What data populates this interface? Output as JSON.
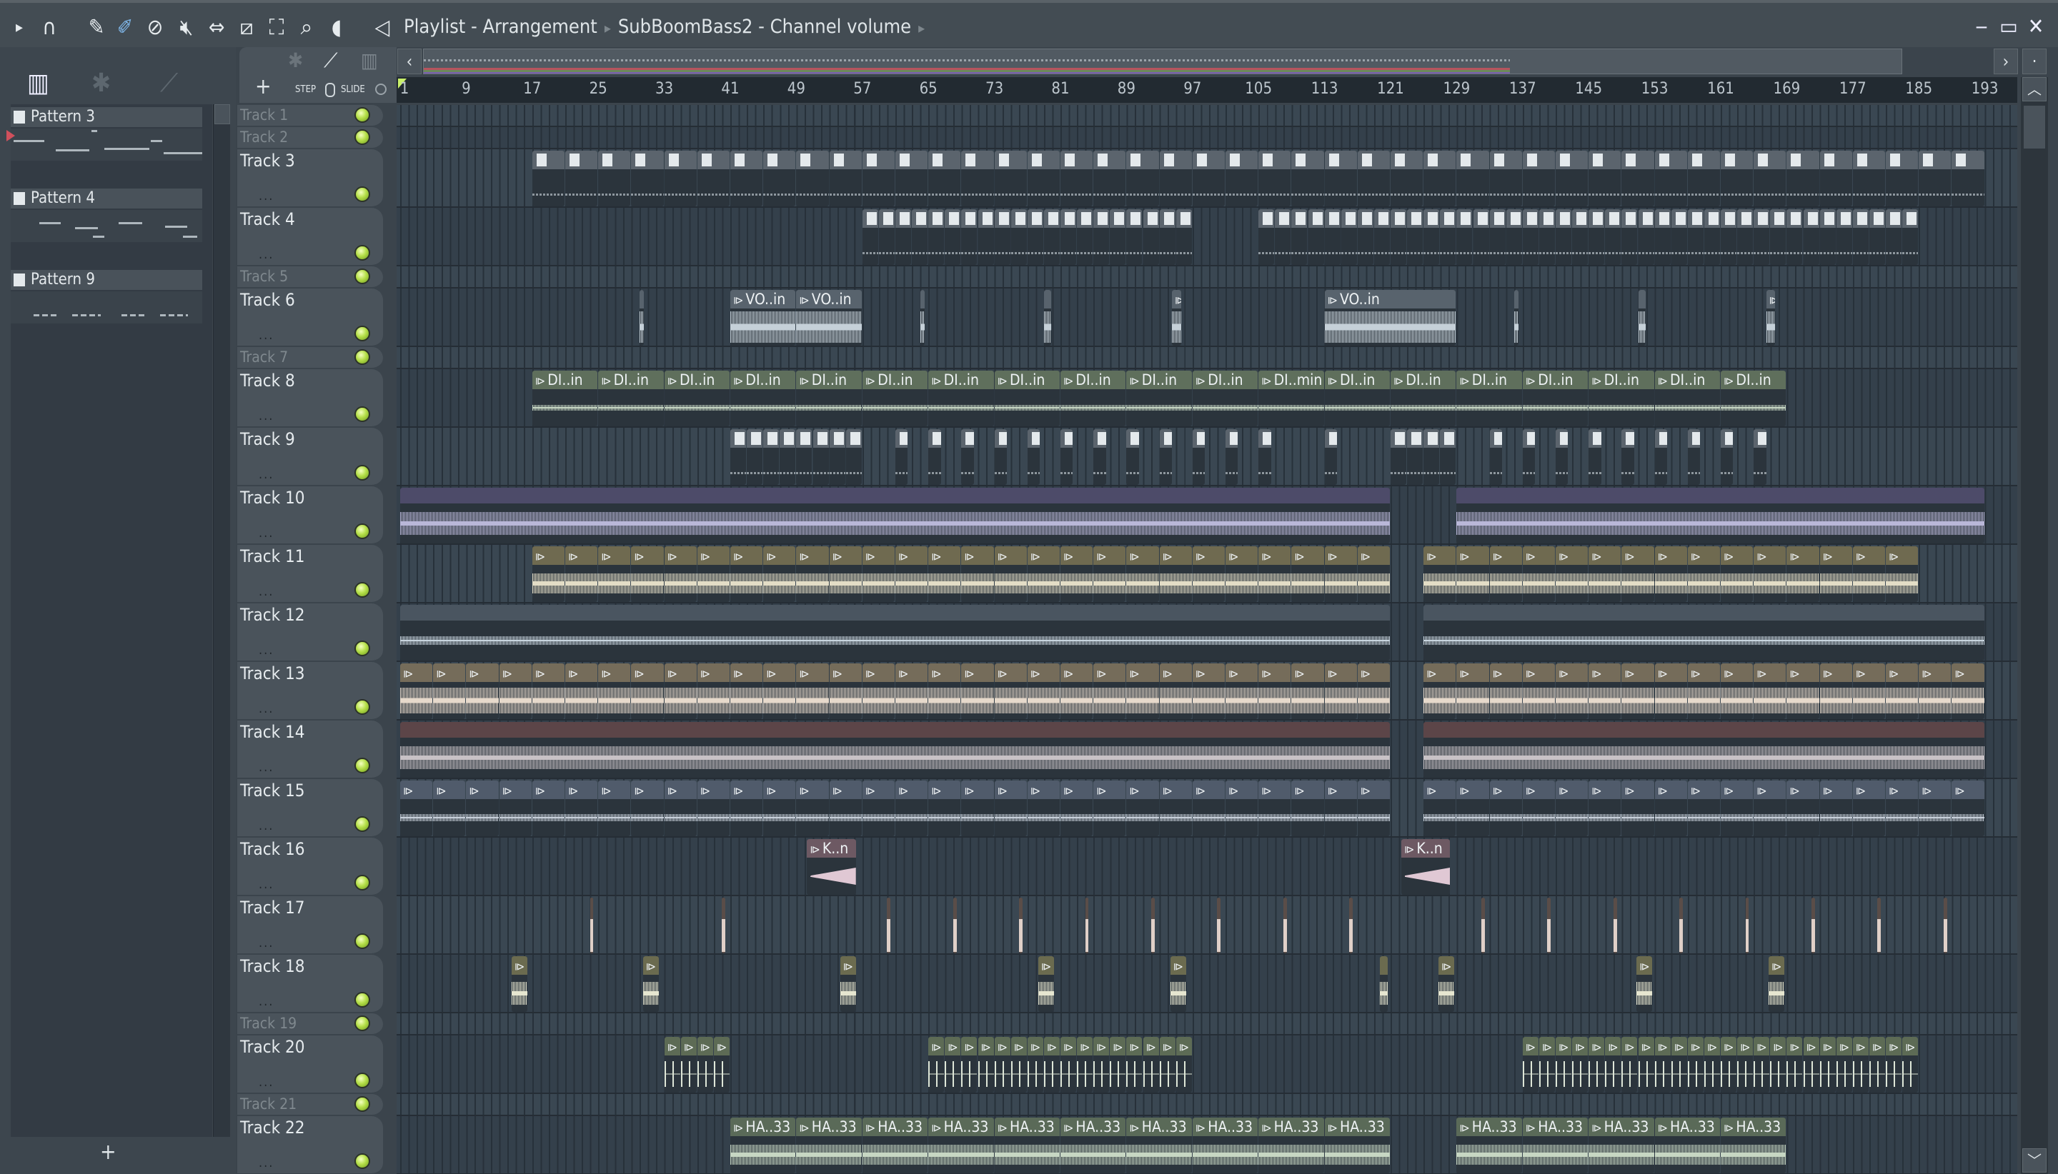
{
  "titlebar": {
    "title": "Playlist - Arrangement",
    "channel": "SubBoomBass2 - Channel volume",
    "tools": [
      "play-arrow-icon",
      "magnet-icon",
      "pencil-icon",
      "paint-icon",
      "delete-icon",
      "mute-icon",
      "slip-icon",
      "slice-icon",
      "select-icon",
      "zoom-icon",
      "playback-icon"
    ],
    "window": {
      "minimize": "‒",
      "maximize": "▭",
      "close": "✕"
    }
  },
  "tabs": {
    "add": "+",
    "step": "STEP",
    "slide": "SLIDE"
  },
  "patterns": [
    {
      "name": "Pattern 3"
    },
    {
      "name": "Pattern 4"
    },
    {
      "name": "Pattern 9"
    }
  ],
  "add_pattern": "+",
  "ruler": [
    1,
    9,
    17,
    25,
    33,
    41,
    49,
    57,
    65,
    73,
    81,
    89,
    97,
    105,
    113,
    121,
    129,
    137,
    145,
    153,
    161,
    169,
    177,
    185,
    193
  ],
  "palette": {
    "pattern": {
      "h": "#5b646d",
      "w": "#aab4bc"
    },
    "vo": {
      "h": "#58636d",
      "w": "#c5d0d8"
    },
    "di": {
      "h": "#5f6f5c",
      "w": "#c6d6c3"
    },
    "pad": {
      "h": "#4d4b69",
      "w": "#b9b7d8"
    },
    "t11": {
      "h": "#6f6a50",
      "w": "#e3ddc6"
    },
    "t12": {
      "h": "#4a5560",
      "w": "#c8d4de"
    },
    "t13": {
      "h": "#756c5a",
      "w": "#e6d9cb"
    },
    "t14": {
      "h": "#5c4548",
      "w": "#c8c2c6"
    },
    "t15": {
      "h": "#505b6b",
      "w": "#c8d0da"
    },
    "kick": {
      "h": "#6d5963",
      "w": "#e0c8d4"
    },
    "t17": {
      "h": "#6a5c54",
      "w": "#e0d0c8"
    },
    "t18": {
      "h": "#6b6b4f",
      "w": "#e6e6d0"
    },
    "t20": {
      "h": "#5d6b55",
      "w": "#dfe7d8"
    },
    "ha": {
      "h": "#5a6a58",
      "w": "#c7d7c3"
    }
  },
  "tracks": [
    {
      "name": "Track 1",
      "small": true,
      "clips": []
    },
    {
      "name": "Track 2",
      "small": true,
      "clips": []
    },
    {
      "name": "Track 3",
      "clips": [
        {
          "start": 17,
          "len": 4,
          "count": 44,
          "type": "pattern",
          "kind": "pattern"
        }
      ]
    },
    {
      "name": "Track 4",
      "clips": [
        {
          "start": 57,
          "len": 2,
          "count": 20,
          "type": "pattern",
          "kind": "pattern"
        },
        {
          "start": 105,
          "len": 2,
          "count": 40,
          "type": "pattern",
          "kind": "pattern"
        }
      ]
    },
    {
      "name": "Track 5",
      "small": true,
      "clips": []
    },
    {
      "name": "Track 6",
      "clips": [
        {
          "start": 30,
          "len": 0.6,
          "count": 1,
          "type": "vo"
        },
        {
          "start": 41,
          "len": 8,
          "count": 2,
          "type": "vo",
          "label": "VO..in"
        },
        {
          "start": 64,
          "len": 0.6,
          "count": 1,
          "type": "vo"
        },
        {
          "start": 79,
          "len": 1,
          "count": 1,
          "type": "vo"
        },
        {
          "start": 94.5,
          "len": 1.2,
          "count": 1,
          "type": "vo"
        },
        {
          "start": 113,
          "len": 16,
          "count": 1,
          "type": "vo",
          "label": "VO..in"
        },
        {
          "start": 136,
          "len": 0.6,
          "count": 1,
          "type": "vo"
        },
        {
          "start": 151,
          "len": 1,
          "count": 1,
          "type": "vo"
        },
        {
          "start": 166.5,
          "len": 1.2,
          "count": 1,
          "type": "vo"
        }
      ]
    },
    {
      "name": "Track 7",
      "small": true,
      "clips": []
    },
    {
      "name": "Track 8",
      "clips": [
        {
          "start": 17,
          "len": 8,
          "count": 11,
          "type": "di",
          "label": "DI..in"
        },
        {
          "start": 105,
          "len": 8,
          "count": 1,
          "type": "di",
          "label": "DI..min"
        },
        {
          "start": 113,
          "len": 8,
          "count": 7,
          "type": "di",
          "label": "DI..in"
        }
      ]
    },
    {
      "name": "Track 9",
      "clips": [
        {
          "start": 41,
          "len": 2,
          "count": 8,
          "type": "pattern",
          "kind": "pattern"
        },
        {
          "start": 61,
          "len": 1.6,
          "count": 1,
          "step": 4,
          "type": "pattern",
          "kind": "pattern"
        },
        {
          "start": 65,
          "len": 1.6,
          "count": 11,
          "step": 4,
          "type": "pattern",
          "kind": "pattern"
        },
        {
          "start": 113,
          "len": 1.6,
          "count": 1,
          "type": "pattern",
          "kind": "pattern"
        },
        {
          "start": 121,
          "len": 2,
          "count": 4,
          "type": "pattern",
          "kind": "pattern"
        },
        {
          "start": 133,
          "len": 1.6,
          "count": 9,
          "step": 4,
          "type": "pattern",
          "kind": "pattern"
        }
      ]
    },
    {
      "name": "Track 10",
      "clips": [
        {
          "start": 1,
          "len": 120,
          "count": 1,
          "type": "pad",
          "noicon": true
        },
        {
          "start": 129,
          "len": 64,
          "count": 1,
          "type": "pad",
          "noicon": true
        }
      ]
    },
    {
      "name": "Track 11",
      "clips": [
        {
          "start": 17,
          "len": 4,
          "count": 26,
          "type": "t11"
        },
        {
          "start": 125,
          "len": 4,
          "count": 15,
          "type": "t11"
        }
      ]
    },
    {
      "name": "Track 12",
      "clips": [
        {
          "start": 1,
          "len": 120,
          "count": 1,
          "type": "t12",
          "noicon": true
        },
        {
          "start": 125,
          "len": 68,
          "count": 1,
          "type": "t12",
          "noicon": true
        }
      ]
    },
    {
      "name": "Track 13",
      "clips": [
        {
          "start": 1,
          "len": 4,
          "count": 30,
          "type": "t13"
        },
        {
          "start": 125,
          "len": 4,
          "count": 17,
          "type": "t13"
        }
      ]
    },
    {
      "name": "Track 14",
      "clips": [
        {
          "start": 1,
          "len": 120,
          "count": 1,
          "type": "t14",
          "noicon": true
        },
        {
          "start": 125,
          "len": 68,
          "count": 1,
          "type": "t14",
          "noicon": true
        }
      ]
    },
    {
      "name": "Track 15",
      "clips": [
        {
          "start": 1,
          "len": 4,
          "count": 30,
          "type": "t15"
        },
        {
          "start": 125,
          "len": 4,
          "count": 17,
          "type": "t15"
        }
      ]
    },
    {
      "name": "Track 16",
      "clips": [
        {
          "start": 50.3,
          "len": 6,
          "count": 1,
          "type": "kick",
          "label": "K..n"
        },
        {
          "start": 122.3,
          "len": 6,
          "count": 1,
          "type": "kick",
          "label": "K..n"
        }
      ]
    },
    {
      "name": "Track 17",
      "clips": [
        {
          "start": 24,
          "len": 0.5,
          "count": 1,
          "type": "t17",
          "noicon": true
        },
        {
          "start": 40,
          "len": 0.5,
          "count": 1,
          "type": "t17",
          "noicon": true
        },
        {
          "start": 60,
          "len": 0.5,
          "count": 8,
          "step": 8,
          "type": "t17",
          "noicon": true
        },
        {
          "start": 132,
          "len": 0.5,
          "count": 8,
          "step": 8,
          "type": "t17",
          "noicon": true
        }
      ]
    },
    {
      "name": "Track 18",
      "clips": [
        {
          "start": 14.5,
          "len": 2,
          "count": 1,
          "type": "t18"
        },
        {
          "start": 30.4,
          "len": 2,
          "count": 1,
          "type": "t18"
        },
        {
          "start": 54.3,
          "len": 2,
          "count": 1,
          "type": "t18"
        },
        {
          "start": 78.3,
          "len": 2,
          "count": 1,
          "type": "t18"
        },
        {
          "start": 94.3,
          "len": 2,
          "count": 1,
          "type": "t18"
        },
        {
          "start": 119.7,
          "len": 1,
          "count": 1,
          "type": "t18",
          "noicon": true
        },
        {
          "start": 126.8,
          "len": 2,
          "count": 1,
          "type": "t18"
        },
        {
          "start": 150.8,
          "len": 2,
          "count": 1,
          "type": "t18"
        },
        {
          "start": 166.8,
          "len": 2,
          "count": 1,
          "type": "t18"
        }
      ]
    },
    {
      "name": "Track 19",
      "small": true,
      "clips": []
    },
    {
      "name": "Track 20",
      "clips": [
        {
          "start": 33,
          "len": 2,
          "count": 4,
          "type": "t20"
        },
        {
          "start": 65,
          "len": 2,
          "count": 16,
          "type": "t20"
        },
        {
          "start": 137,
          "len": 2,
          "count": 24,
          "type": "t20"
        }
      ]
    },
    {
      "name": "Track 21",
      "small": true,
      "clips": []
    },
    {
      "name": "Track 22",
      "clips": [
        {
          "start": 41,
          "len": 8,
          "count": 10,
          "type": "ha",
          "label": "HA..33"
        },
        {
          "start": 129,
          "len": 8,
          "count": 5,
          "type": "ha",
          "label": "HA..33"
        }
      ]
    }
  ]
}
